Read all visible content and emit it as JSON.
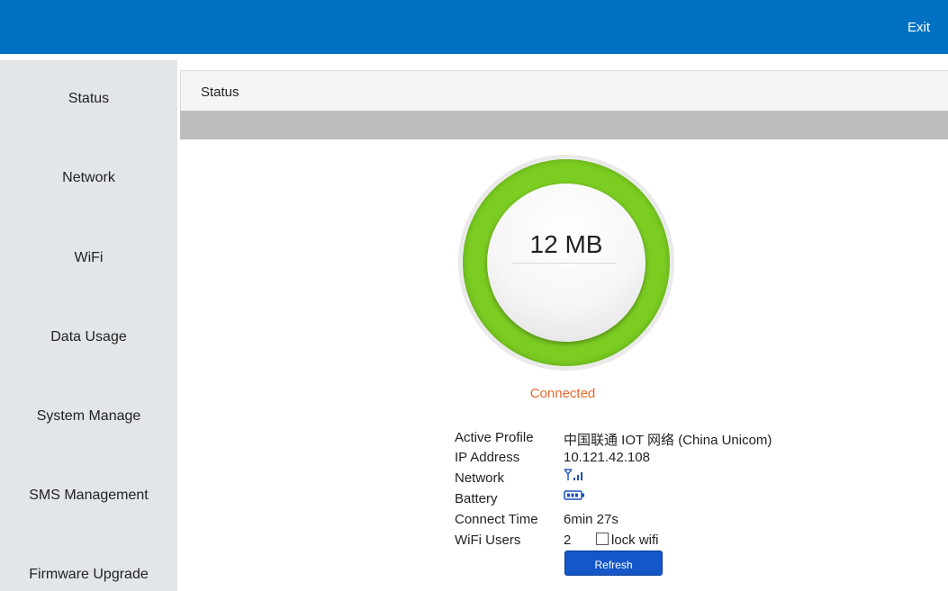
{
  "header": {
    "exit_label": "Exit"
  },
  "sidebar": {
    "items": [
      {
        "label": "Status"
      },
      {
        "label": "Network"
      },
      {
        "label": "WiFi"
      },
      {
        "label": "Data Usage"
      },
      {
        "label": "System Manage"
      },
      {
        "label": "SMS Management"
      },
      {
        "label": "Firmware Upgrade"
      }
    ]
  },
  "main": {
    "panel_title": "Status",
    "gauge": {
      "value": "12 MB",
      "ring_color": "#7ccd22"
    },
    "connection_status": "Connected",
    "connection_status_color": "#e8672a",
    "info": {
      "active_profile_label": "Active Profile",
      "active_profile_value": "中国联通 IOT 网络 (China Unicom)",
      "ip_label": "IP Address",
      "ip_value": "10.121.42.108",
      "network_label": "Network",
      "network_icon": "signal-strength-icon",
      "battery_label": "Battery",
      "battery_icon": "battery-icon",
      "connect_time_label": "Connect Time",
      "connect_time_value": "6min 27s",
      "wifi_users_label": "WiFi Users",
      "wifi_users_value": "2",
      "lock_wifi_label": "lock wifi",
      "lock_wifi_checked": false
    },
    "refresh_label": "Refresh"
  },
  "colors": {
    "topbar": "#0071c2",
    "sidebar": "#e2e6e9",
    "button": "#1557c8"
  }
}
